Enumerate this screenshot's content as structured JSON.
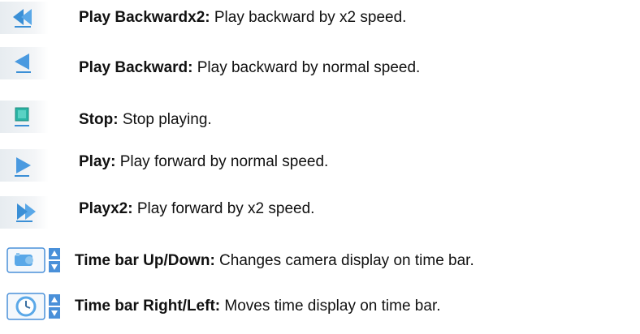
{
  "items": [
    {
      "icon": "play-backward-x2-icon",
      "title": "Play Backwardx2:",
      "text": " Play backward by x2 speed."
    },
    {
      "icon": "play-backward-icon",
      "title": "Play Backward:",
      "text": " Play backward by normal speed."
    },
    {
      "icon": "stop-icon",
      "title": "Stop:",
      "text": " Stop playing."
    },
    {
      "icon": "play-icon",
      "title": "Play:",
      "text": " Play forward by normal speed."
    },
    {
      "icon": "play-x2-icon",
      "title": "Playx2:",
      "text": "  Play forward by x2 speed."
    },
    {
      "icon": "camera-updown-icon",
      "title": "Time bar Up/Down:",
      "text": " Changes camera display on time bar."
    },
    {
      "icon": "clock-rightleft-icon",
      "title": "Time bar Right/Left:",
      "text": " Moves time display on time bar."
    }
  ],
  "colors": {
    "accent": "#3a8fd6",
    "stop": "#2bb5a5",
    "spinner": "#4a90d9"
  }
}
